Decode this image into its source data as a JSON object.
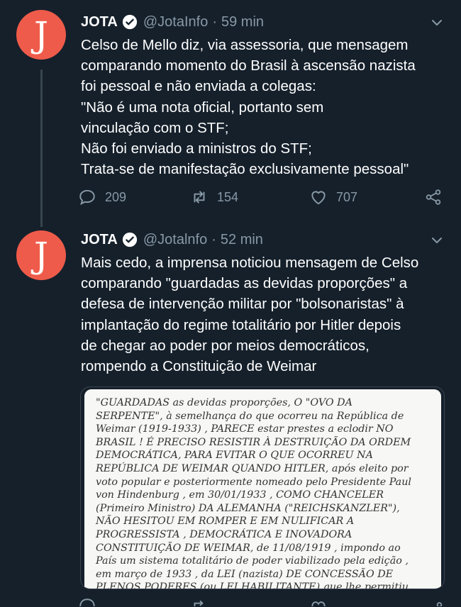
{
  "tweets": [
    {
      "name": "JOTA",
      "handle": "@JotaInfo",
      "time": "59 min",
      "text": "Celso de Mello diz, via assessoria, que mensagem\ncomparando momento do Brasil à ascensão nazista\nfoi pessoal e não enviada a colegas:\n\"Não é uma nota oficial, portanto sem\nvinculação com o STF;\nNão foi enviado a ministros do STF;\nTrata-se de manifestação exclusivamente pessoal\"",
      "replies": "209",
      "retweets": "154",
      "likes": "707"
    },
    {
      "name": "JOTA",
      "handle": "@Jotalnfo",
      "time": "52 min",
      "text": "Mais cedo, a imprensa noticiou mensagem de Celso\ncomparando \"guardadas as devidas proporções\" a\ndefesa de intervenção militar por \"bolsonaristas\" à\nimplantação do regime totalitário por Hitler depois\nde chegar ao poder por meios democráticos,\nrompendo a Constituição de Weimar",
      "card_text": "\"GUARDADAS as devidas proporções, O \"OVO DA\nSERPENTE\", à semelhança do que ocorreu na República de\nWeimar (1919-1933) , PARECE estar prestes a eclodir NO\nBRASIL ! É PRECISO RESISTIR À DESTRUIÇÃO DA ORDEM\nDEMOCRÁTICA, PARA EVITAR O QUE OCORREU NA\nREPÚBLICA DE WEIMAR QUANDO HITLER, após eleito por\nvoto popular e posteriormente nomeado pelo Presidente Paul\nvon Hindenburg , em 30/01/1933 , COMO CHANCELER\n(Primeiro Ministro) DA ALEMANHA (\"REICHSKANZLER\"),\nNÃO HESITOU EM ROMPER E EM NULIFICAR A\nPROGRESSISTA , DEMOCRÁTICA E INOVADORA\nCONSTITUIÇÃO DE WEIMAR, de 11/08/1919 , impondo ao\nPaís um sistema totalitário de poder viabilizado pela edição ,\nem março de 1933 , da LEI (nazista) DE CONCESSÃO DE\nPLENOS PODERES (ou LEI HABILITANTE) que lhe permitiu"
    }
  ],
  "separator": "·",
  "avatar_glyph": "J",
  "colors": {
    "background": "#15202b",
    "avatar": "#ef5b4a",
    "muted": "#8899a6",
    "verified": "#ffffff"
  },
  "icons": [
    "verified-icon",
    "chevron-down-icon",
    "reply-icon",
    "retweet-icon",
    "like-icon",
    "share-icon"
  ]
}
